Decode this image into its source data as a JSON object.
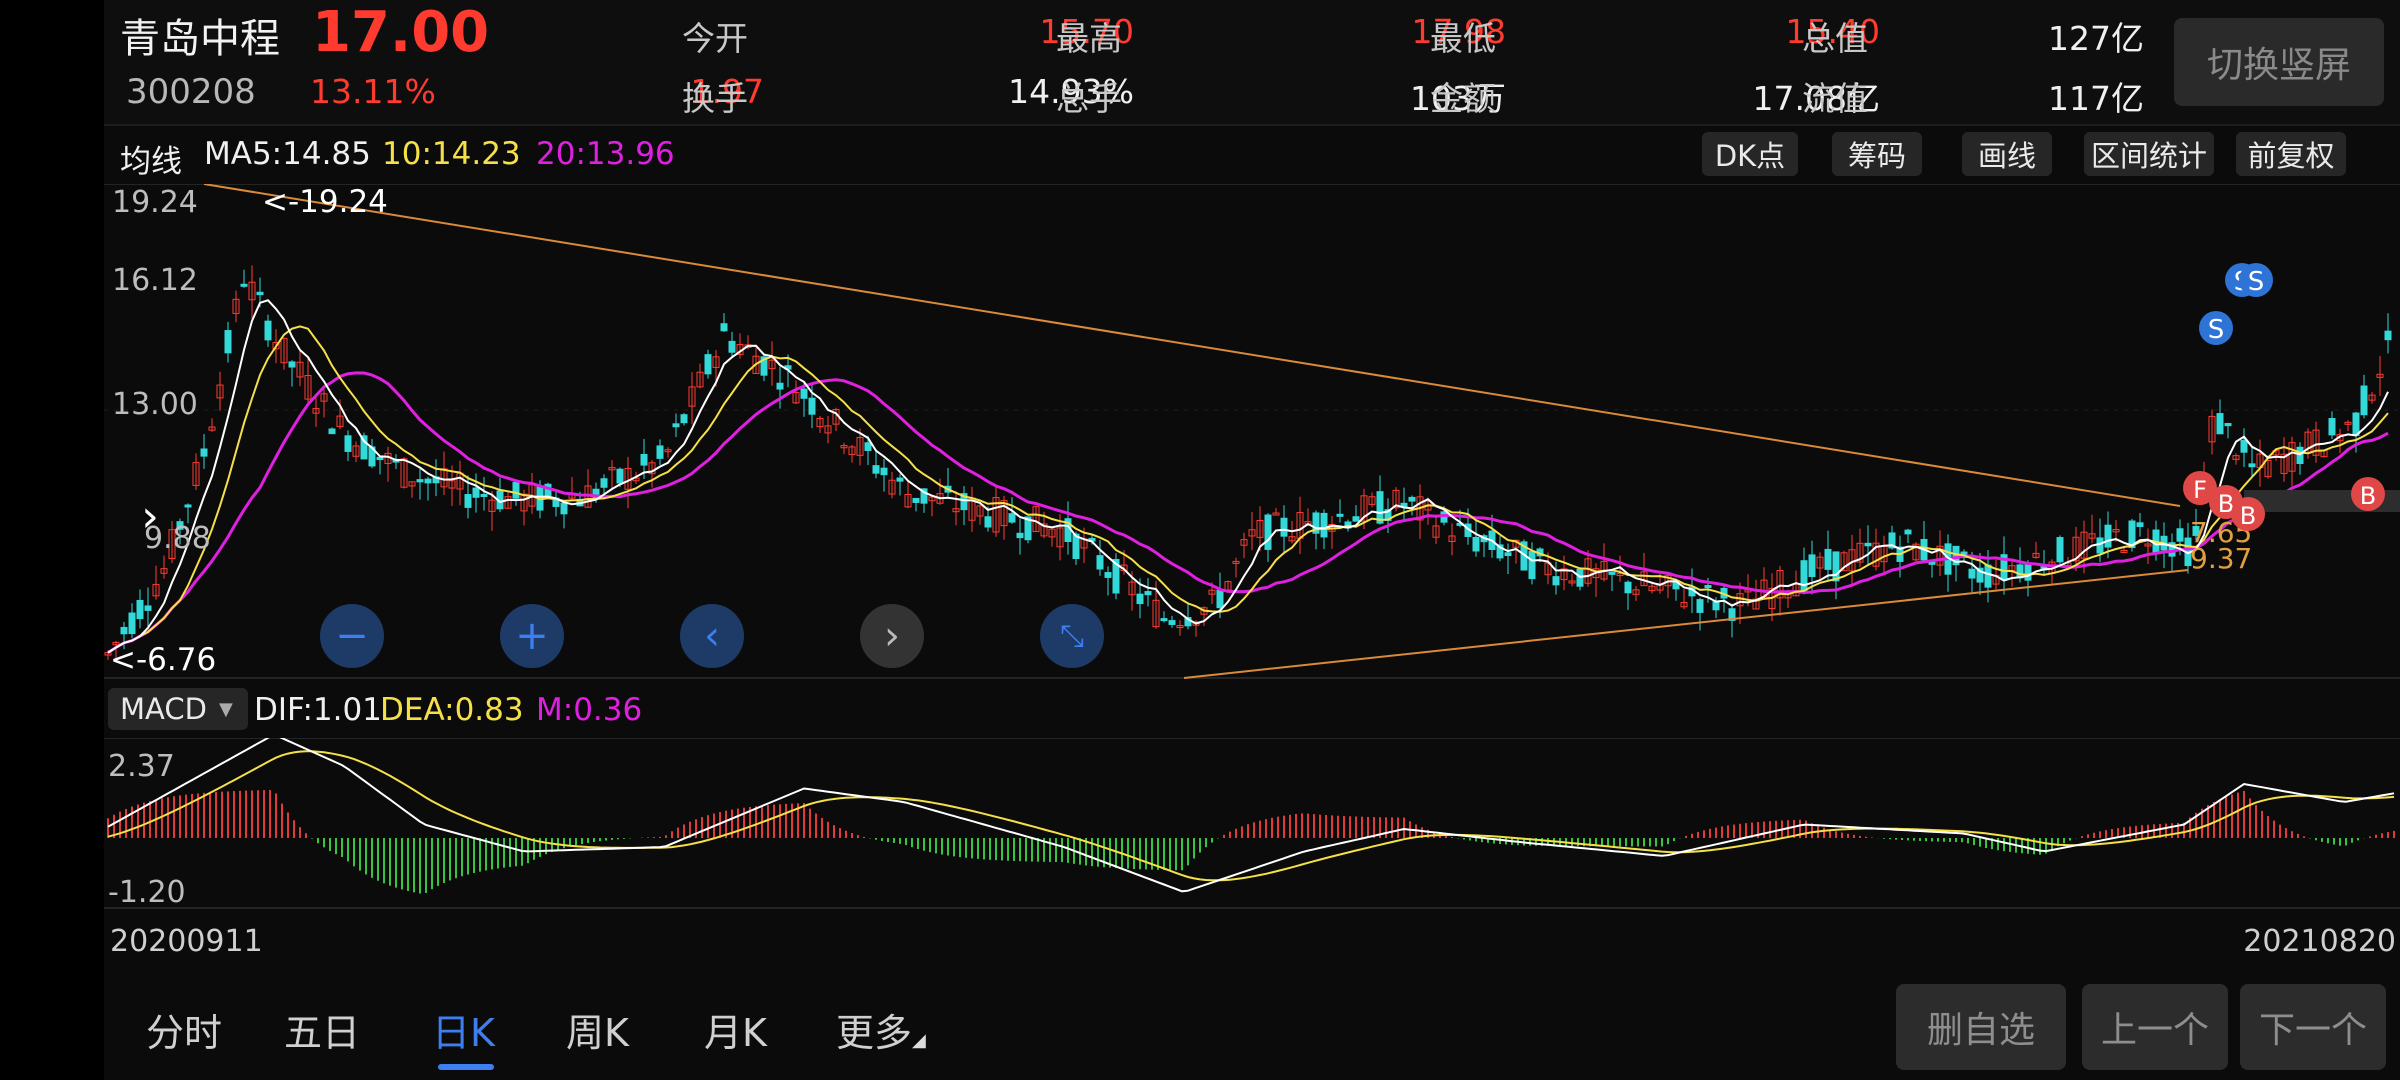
{
  "quote": {
    "name": "青岛中程",
    "price": "17.00",
    "code": "300208",
    "change_pct": "13.11%",
    "change": "1.97",
    "open_label": "今开",
    "open": "15.70",
    "high_label": "最高",
    "high": "17.98",
    "low_label": "最低",
    "low": "15.40",
    "total_cap_label": "总值",
    "total_cap": "127亿",
    "turnover_label": "换手",
    "turnover": "14.93%",
    "volume_label": "总手",
    "volume": "103万",
    "amount_label": "金额",
    "amount": "17.08亿",
    "float_cap_label": "流值",
    "float_cap": "117亿",
    "portrait_button": "切换竖屏"
  },
  "ma_bar": {
    "label": "均线",
    "ma5": "MA5:14.85",
    "ma10": "10:14.23",
    "ma20": "20:13.96",
    "tools": [
      "DK点",
      "筹码",
      "画线",
      "区间统计",
      "前复权"
    ]
  },
  "main_chart": {
    "y_labels": [
      "19.24",
      "16.12",
      "13.00",
      "9.88"
    ],
    "max_mark": "<-19.24",
    "min_mark": "<-6.76",
    "right_labels": [
      "7.65",
      "9.37"
    ],
    "signals": {
      "S": "S",
      "B": "B",
      "F": "F"
    }
  },
  "macd_bar": {
    "selector": "MACD",
    "dif": "DIF:1.01",
    "dea": "DEA:0.83",
    "m": "M:0.36",
    "y_top": "2.37",
    "y_bottom": "-1.20"
  },
  "dates": {
    "start": "20200911",
    "end": "20210820"
  },
  "tabs": [
    "分时",
    "五日",
    "日K",
    "周K",
    "月K",
    "更多"
  ],
  "buttons": {
    "remove": "删自选",
    "prev": "上一个",
    "next": "下一个"
  },
  "colors": {
    "up": "#ff3b30",
    "down": "#33d8d8",
    "ma5": "#ffffff",
    "ma10": "#f5e04a",
    "ma20": "#e020e0",
    "trend": "#d98a3a",
    "accent": "#3d7ff0"
  }
}
